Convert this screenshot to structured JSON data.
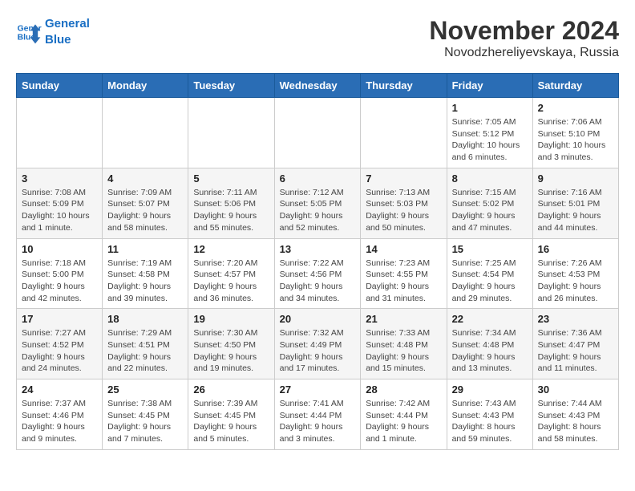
{
  "header": {
    "logo_line1": "General",
    "logo_line2": "Blue",
    "month_title": "November 2024",
    "location": "Novodzhereliyevskaya, Russia"
  },
  "days_of_week": [
    "Sunday",
    "Monday",
    "Tuesday",
    "Wednesday",
    "Thursday",
    "Friday",
    "Saturday"
  ],
  "weeks": [
    [
      {
        "day": "",
        "info": ""
      },
      {
        "day": "",
        "info": ""
      },
      {
        "day": "",
        "info": ""
      },
      {
        "day": "",
        "info": ""
      },
      {
        "day": "",
        "info": ""
      },
      {
        "day": "1",
        "info": "Sunrise: 7:05 AM\nSunset: 5:12 PM\nDaylight: 10 hours and 6 minutes."
      },
      {
        "day": "2",
        "info": "Sunrise: 7:06 AM\nSunset: 5:10 PM\nDaylight: 10 hours and 3 minutes."
      }
    ],
    [
      {
        "day": "3",
        "info": "Sunrise: 7:08 AM\nSunset: 5:09 PM\nDaylight: 10 hours and 1 minute."
      },
      {
        "day": "4",
        "info": "Sunrise: 7:09 AM\nSunset: 5:07 PM\nDaylight: 9 hours and 58 minutes."
      },
      {
        "day": "5",
        "info": "Sunrise: 7:11 AM\nSunset: 5:06 PM\nDaylight: 9 hours and 55 minutes."
      },
      {
        "day": "6",
        "info": "Sunrise: 7:12 AM\nSunset: 5:05 PM\nDaylight: 9 hours and 52 minutes."
      },
      {
        "day": "7",
        "info": "Sunrise: 7:13 AM\nSunset: 5:03 PM\nDaylight: 9 hours and 50 minutes."
      },
      {
        "day": "8",
        "info": "Sunrise: 7:15 AM\nSunset: 5:02 PM\nDaylight: 9 hours and 47 minutes."
      },
      {
        "day": "9",
        "info": "Sunrise: 7:16 AM\nSunset: 5:01 PM\nDaylight: 9 hours and 44 minutes."
      }
    ],
    [
      {
        "day": "10",
        "info": "Sunrise: 7:18 AM\nSunset: 5:00 PM\nDaylight: 9 hours and 42 minutes."
      },
      {
        "day": "11",
        "info": "Sunrise: 7:19 AM\nSunset: 4:58 PM\nDaylight: 9 hours and 39 minutes."
      },
      {
        "day": "12",
        "info": "Sunrise: 7:20 AM\nSunset: 4:57 PM\nDaylight: 9 hours and 36 minutes."
      },
      {
        "day": "13",
        "info": "Sunrise: 7:22 AM\nSunset: 4:56 PM\nDaylight: 9 hours and 34 minutes."
      },
      {
        "day": "14",
        "info": "Sunrise: 7:23 AM\nSunset: 4:55 PM\nDaylight: 9 hours and 31 minutes."
      },
      {
        "day": "15",
        "info": "Sunrise: 7:25 AM\nSunset: 4:54 PM\nDaylight: 9 hours and 29 minutes."
      },
      {
        "day": "16",
        "info": "Sunrise: 7:26 AM\nSunset: 4:53 PM\nDaylight: 9 hours and 26 minutes."
      }
    ],
    [
      {
        "day": "17",
        "info": "Sunrise: 7:27 AM\nSunset: 4:52 PM\nDaylight: 9 hours and 24 minutes."
      },
      {
        "day": "18",
        "info": "Sunrise: 7:29 AM\nSunset: 4:51 PM\nDaylight: 9 hours and 22 minutes."
      },
      {
        "day": "19",
        "info": "Sunrise: 7:30 AM\nSunset: 4:50 PM\nDaylight: 9 hours and 19 minutes."
      },
      {
        "day": "20",
        "info": "Sunrise: 7:32 AM\nSunset: 4:49 PM\nDaylight: 9 hours and 17 minutes."
      },
      {
        "day": "21",
        "info": "Sunrise: 7:33 AM\nSunset: 4:48 PM\nDaylight: 9 hours and 15 minutes."
      },
      {
        "day": "22",
        "info": "Sunrise: 7:34 AM\nSunset: 4:48 PM\nDaylight: 9 hours and 13 minutes."
      },
      {
        "day": "23",
        "info": "Sunrise: 7:36 AM\nSunset: 4:47 PM\nDaylight: 9 hours and 11 minutes."
      }
    ],
    [
      {
        "day": "24",
        "info": "Sunrise: 7:37 AM\nSunset: 4:46 PM\nDaylight: 9 hours and 9 minutes."
      },
      {
        "day": "25",
        "info": "Sunrise: 7:38 AM\nSunset: 4:45 PM\nDaylight: 9 hours and 7 minutes."
      },
      {
        "day": "26",
        "info": "Sunrise: 7:39 AM\nSunset: 4:45 PM\nDaylight: 9 hours and 5 minutes."
      },
      {
        "day": "27",
        "info": "Sunrise: 7:41 AM\nSunset: 4:44 PM\nDaylight: 9 hours and 3 minutes."
      },
      {
        "day": "28",
        "info": "Sunrise: 7:42 AM\nSunset: 4:44 PM\nDaylight: 9 hours and 1 minute."
      },
      {
        "day": "29",
        "info": "Sunrise: 7:43 AM\nSunset: 4:43 PM\nDaylight: 8 hours and 59 minutes."
      },
      {
        "day": "30",
        "info": "Sunrise: 7:44 AM\nSunset: 4:43 PM\nDaylight: 8 hours and 58 minutes."
      }
    ]
  ]
}
